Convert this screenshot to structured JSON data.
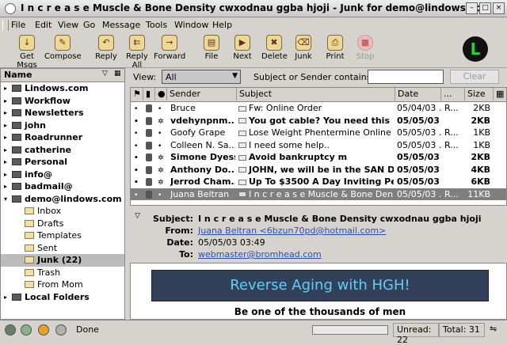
{
  "window": {
    "title": "I n c r e a s e  Muscle & Bone Density cwxodnau ggba hjoji - Junk for demo@lindows.com"
  },
  "menu": [
    "File",
    "Edit",
    "View",
    "Go",
    "Message",
    "Tools",
    "Window",
    "Help"
  ],
  "toolbar": {
    "buttons": [
      {
        "label": "Get Msgs",
        "icon": "get-messages-icon"
      },
      {
        "label": "Compose",
        "icon": "compose-icon"
      },
      {
        "label": "Reply",
        "icon": "reply-icon"
      },
      {
        "label": "Reply All",
        "icon": "reply-all-icon"
      },
      {
        "label": "Forward",
        "icon": "forward-icon"
      },
      {
        "label": "File",
        "icon": "file-icon"
      },
      {
        "label": "Next",
        "icon": "next-icon"
      },
      {
        "label": "Delete",
        "icon": "delete-icon"
      },
      {
        "label": "Junk",
        "icon": "junk-icon"
      },
      {
        "label": "Print",
        "icon": "print-icon"
      },
      {
        "label": "Stop",
        "icon": "stop-icon",
        "disabled": true
      }
    ],
    "logo_text": "L"
  },
  "folders": {
    "header": "Name",
    "items": [
      {
        "label": "Lindows.com",
        "bold": true,
        "level": 0,
        "expanded": false
      },
      {
        "label": "Workflow",
        "bold": true,
        "level": 0,
        "expanded": false
      },
      {
        "label": "Newsletters",
        "bold": true,
        "level": 0,
        "expanded": false
      },
      {
        "label": "john",
        "bold": true,
        "level": 0,
        "expanded": false
      },
      {
        "label": "Roadrunner",
        "bold": true,
        "level": 0,
        "expanded": false
      },
      {
        "label": "catherine",
        "bold": true,
        "level": 0,
        "expanded": false
      },
      {
        "label": "Personal",
        "bold": true,
        "level": 0,
        "expanded": false
      },
      {
        "label": "info@",
        "bold": true,
        "level": 0,
        "expanded": false
      },
      {
        "label": "badmail@",
        "bold": true,
        "level": 0,
        "expanded": false
      },
      {
        "label": "demo@lindows.com",
        "bold": true,
        "level": 0,
        "expanded": true
      },
      {
        "label": "Inbox",
        "bold": false,
        "level": 1
      },
      {
        "label": "Drafts",
        "bold": false,
        "level": 1
      },
      {
        "label": "Templates",
        "bold": false,
        "level": 1
      },
      {
        "label": "Sent",
        "bold": false,
        "level": 1
      },
      {
        "label": "Junk (22)",
        "bold": true,
        "level": 1,
        "selected": true
      },
      {
        "label": "Trash",
        "bold": false,
        "level": 1
      },
      {
        "label": "From Mom",
        "bold": false,
        "level": 1
      },
      {
        "label": "Local Folders",
        "bold": true,
        "level": 0,
        "expanded": false
      }
    ]
  },
  "viewbar": {
    "view_label": "View:",
    "view_value": "All",
    "search_label": "Subject or Sender contains:",
    "search_value": "",
    "clear_label": "Clear"
  },
  "thread": {
    "columns": [
      "Sender",
      "Subject",
      "Date",
      "...",
      "Size"
    ],
    "rows": [
      {
        "sender": "Bruce",
        "subject": "Fw:  Online Order",
        "date": "05/04/03 ...",
        "extra": "R...",
        "size": "2KB",
        "unread": false
      },
      {
        "sender": "vdehynpnm...",
        "subject": "You got cable?  You need this ...",
        "date": "05/05/03 ...",
        "extra": "",
        "size": "2KB",
        "unread": true
      },
      {
        "sender": "Goofy Grape",
        "subject": "Lose Weight Phentermine Online",
        "date": "05/05/03 ...",
        "extra": "R...",
        "size": "1KB",
        "unread": false
      },
      {
        "sender": "Colleen N. Sa...",
        "subject": "I need some help..",
        "date": "05/05/03 ...",
        "extra": "R...",
        "size": "1KB",
        "unread": false
      },
      {
        "sender": "Simone Dyess",
        "subject": "Avoid bankruptcy m",
        "date": "05/05/03 ...",
        "extra": "",
        "size": "2KB",
        "unread": true
      },
      {
        "sender": "Anthony Do...",
        "subject": "JOHN, we will be in the SAN DIE...",
        "date": "05/05/03 ...",
        "extra": "",
        "size": "4KB",
        "unread": true
      },
      {
        "sender": "Jerrod Cham...",
        "subject": "Up To $3500 A Day Inviting Peo...",
        "date": "05/05/03 ...",
        "extra": "",
        "size": "6KB",
        "unread": true
      },
      {
        "sender": "Juana Beltran",
        "subject": "I n c r e a s e  Muscle & Bone Den...",
        "date": "05/05/03 ...",
        "extra": "R...",
        "size": "11KB",
        "unread": false,
        "selected": true
      }
    ]
  },
  "message": {
    "labels": {
      "subject": "Subject:",
      "from": "From:",
      "date": "Date:",
      "to": "To:"
    },
    "subject": "I n c r e a s e  Muscle & Bone Density cwxodnau ggba hjoji",
    "from": "Juana Beltran <6bzun70pd@hotmail.com>",
    "date": "05/05/03 03:49",
    "to": "webmaster@bromhead.com",
    "banner": "Reverse Aging with HGH!",
    "tagline": "Be one of the thousands of men"
  },
  "status": {
    "text": "Done",
    "progress": 0,
    "unread_label": "Unread:",
    "unread": "22",
    "total_label": "Total:",
    "total": "31"
  },
  "colors": {
    "chrome": "#d6d3ce",
    "selection": "#7f7f7f",
    "link": "#2a4fb0",
    "banner_bg": "#33405a",
    "banner_text": "#5cd0f5"
  }
}
